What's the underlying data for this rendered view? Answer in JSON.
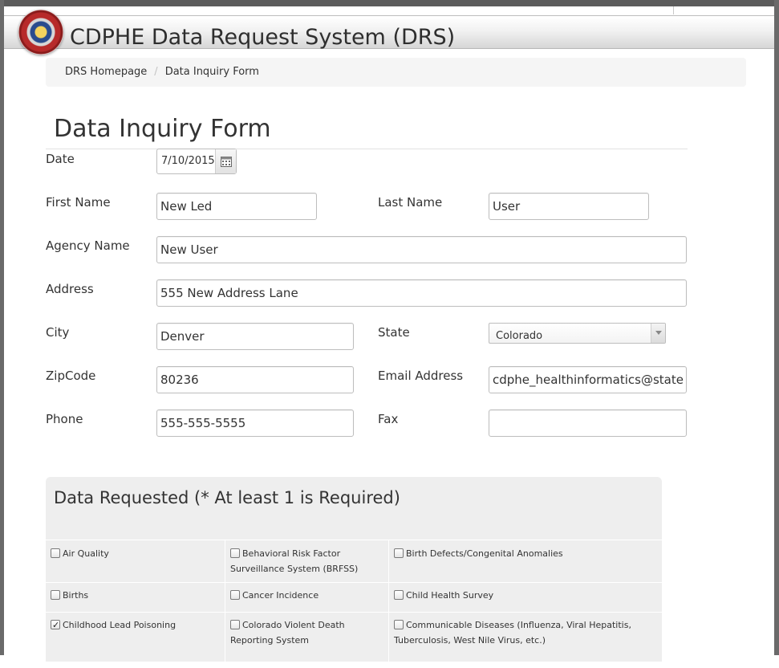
{
  "app": {
    "title": "CDPHE Data Request System (DRS)"
  },
  "breadcrumb": {
    "items": [
      {
        "label": "DRS Homepage"
      },
      {
        "label": "Data Inquiry Form"
      }
    ],
    "separator": "/"
  },
  "form": {
    "title": "Data Inquiry Form",
    "date": {
      "label": "Date",
      "value": "7/10/2015"
    },
    "first_name": {
      "label": "First Name",
      "value": "New Led"
    },
    "last_name": {
      "label": "Last Name",
      "value": "User"
    },
    "agency_name": {
      "label": "Agency Name",
      "value": "New User"
    },
    "address": {
      "label": "Address",
      "value": "555 New Address Lane"
    },
    "city": {
      "label": "City",
      "value": "Denver"
    },
    "state": {
      "label": "State",
      "value": "Colorado"
    },
    "zipcode": {
      "label": "ZipCode",
      "value": "80236"
    },
    "email": {
      "label": "Email Address",
      "value": "cdphe_healthinformatics@state"
    },
    "phone": {
      "label": "Phone",
      "value": "555-555-5555"
    },
    "fax": {
      "label": "Fax",
      "value": ""
    }
  },
  "data_requested": {
    "title": "Data Requested (* At least 1 is Required)",
    "options": [
      {
        "label": "Air Quality",
        "checked": false
      },
      {
        "label": "Behavioral Risk Factor Surveillance System (BRFSS)",
        "checked": false
      },
      {
        "label": "Birth Defects/Congenital Anomalies",
        "checked": false
      },
      {
        "label": "Births",
        "checked": false
      },
      {
        "label": "Cancer Incidence",
        "checked": false
      },
      {
        "label": "Child Health Survey",
        "checked": false
      },
      {
        "label": "Childhood Lead Poisoning",
        "checked": true
      },
      {
        "label": "Colorado Violent Death Reporting System",
        "checked": false
      },
      {
        "label": "Communicable Diseases (Influenza, Viral Hepatitis, Tuberculosis, West Nile Virus, etc.)",
        "checked": false
      }
    ]
  },
  "icons": {
    "logo": "state-seal-icon",
    "calendar": "calendar-icon",
    "dropdown": "chevron-down-icon"
  }
}
